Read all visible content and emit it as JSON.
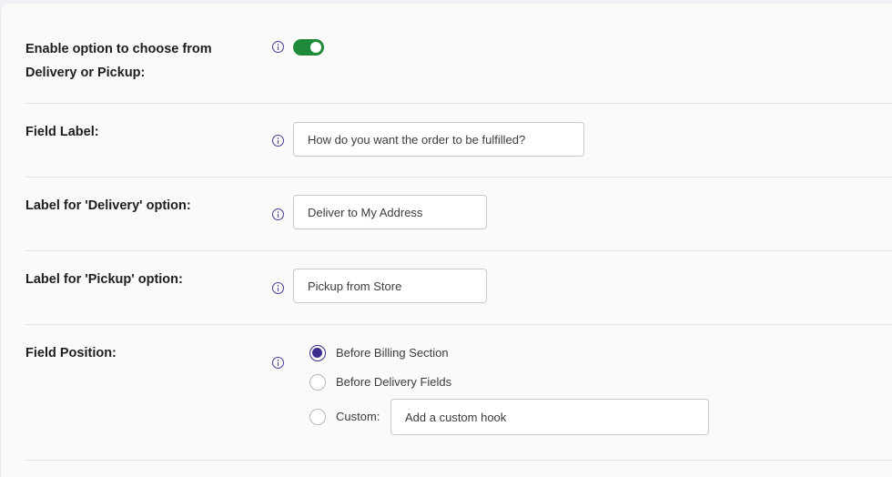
{
  "settings": {
    "enable_option": {
      "label": "Enable option to choose from Delivery or Pickup:",
      "enabled": true
    },
    "field_label": {
      "label": "Field Label:",
      "value": "How do you want the order to be fulfilled?"
    },
    "delivery_label": {
      "label": "Label for 'Delivery' option:",
      "value": "Deliver to My Address"
    },
    "pickup_label": {
      "label": "Label for 'Pickup' option:",
      "value": "Pickup from Store"
    },
    "field_position": {
      "label": "Field Position:",
      "options": [
        {
          "label": "Before Billing Section",
          "checked": true
        },
        {
          "label": "Before Delivery Fields",
          "checked": false
        },
        {
          "label": "Custom:",
          "checked": false
        }
      ],
      "custom_hook_value": "Add a custom hook"
    }
  },
  "colors": {
    "toggle_on": "#1e8a3a",
    "accent": "#3b2b8a"
  }
}
